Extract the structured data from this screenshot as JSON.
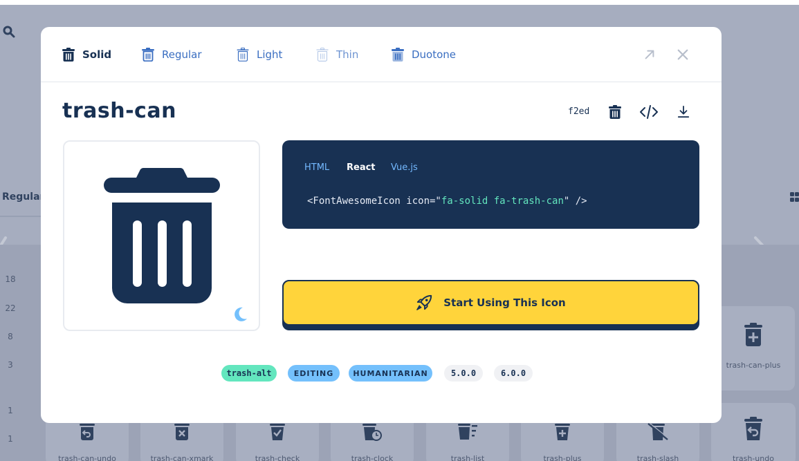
{
  "background": {
    "tab_label": "Regular",
    "row_numbers": [
      "18",
      "22",
      "8",
      "3",
      "1",
      "1"
    ],
    "cards": [
      {
        "label": "trash-can-plus"
      },
      {
        "label": "trash-can-undo"
      },
      {
        "label": "trash-can-xmark"
      },
      {
        "label": "trash-check"
      },
      {
        "label": "trash-clock"
      },
      {
        "label": "trash-list"
      },
      {
        "label": "trash-plus"
      },
      {
        "label": "trash-slash"
      },
      {
        "label": "trash-undo"
      }
    ]
  },
  "modal": {
    "style_tabs": [
      {
        "label": "Solid",
        "icon": "trash-can-solid-icon",
        "active": true
      },
      {
        "label": "Regular",
        "icon": "trash-can-regular-icon"
      },
      {
        "label": "Light",
        "icon": "trash-can-light-icon"
      },
      {
        "label": "Thin",
        "icon": "trash-can-thin-icon"
      },
      {
        "label": "Duotone",
        "icon": "trash-can-duotone-icon"
      }
    ],
    "icon_name": "trash-can",
    "unicode": "f2ed",
    "code": {
      "tabs": [
        "HTML",
        "React",
        "Vue.js"
      ],
      "active_tab": "React",
      "line_prefix": "<FontAwesomeIcon icon=\"",
      "line_value": "fa-solid fa-trash-can",
      "line_suffix": "\" />"
    },
    "start_button_label": "Start Using This Icon",
    "tags": {
      "alias": "trash-alt",
      "categories": [
        "EDITING",
        "HUMANITARIAN"
      ],
      "versions": [
        "5.0.0",
        "6.0.0"
      ]
    }
  },
  "colors": {
    "navy": "#183153",
    "yellow": "#ffd43b",
    "blue_link": "#3a6ec1",
    "mint": "#63e6be",
    "sky": "#74c0fc",
    "overlay": "#a6adbf"
  }
}
